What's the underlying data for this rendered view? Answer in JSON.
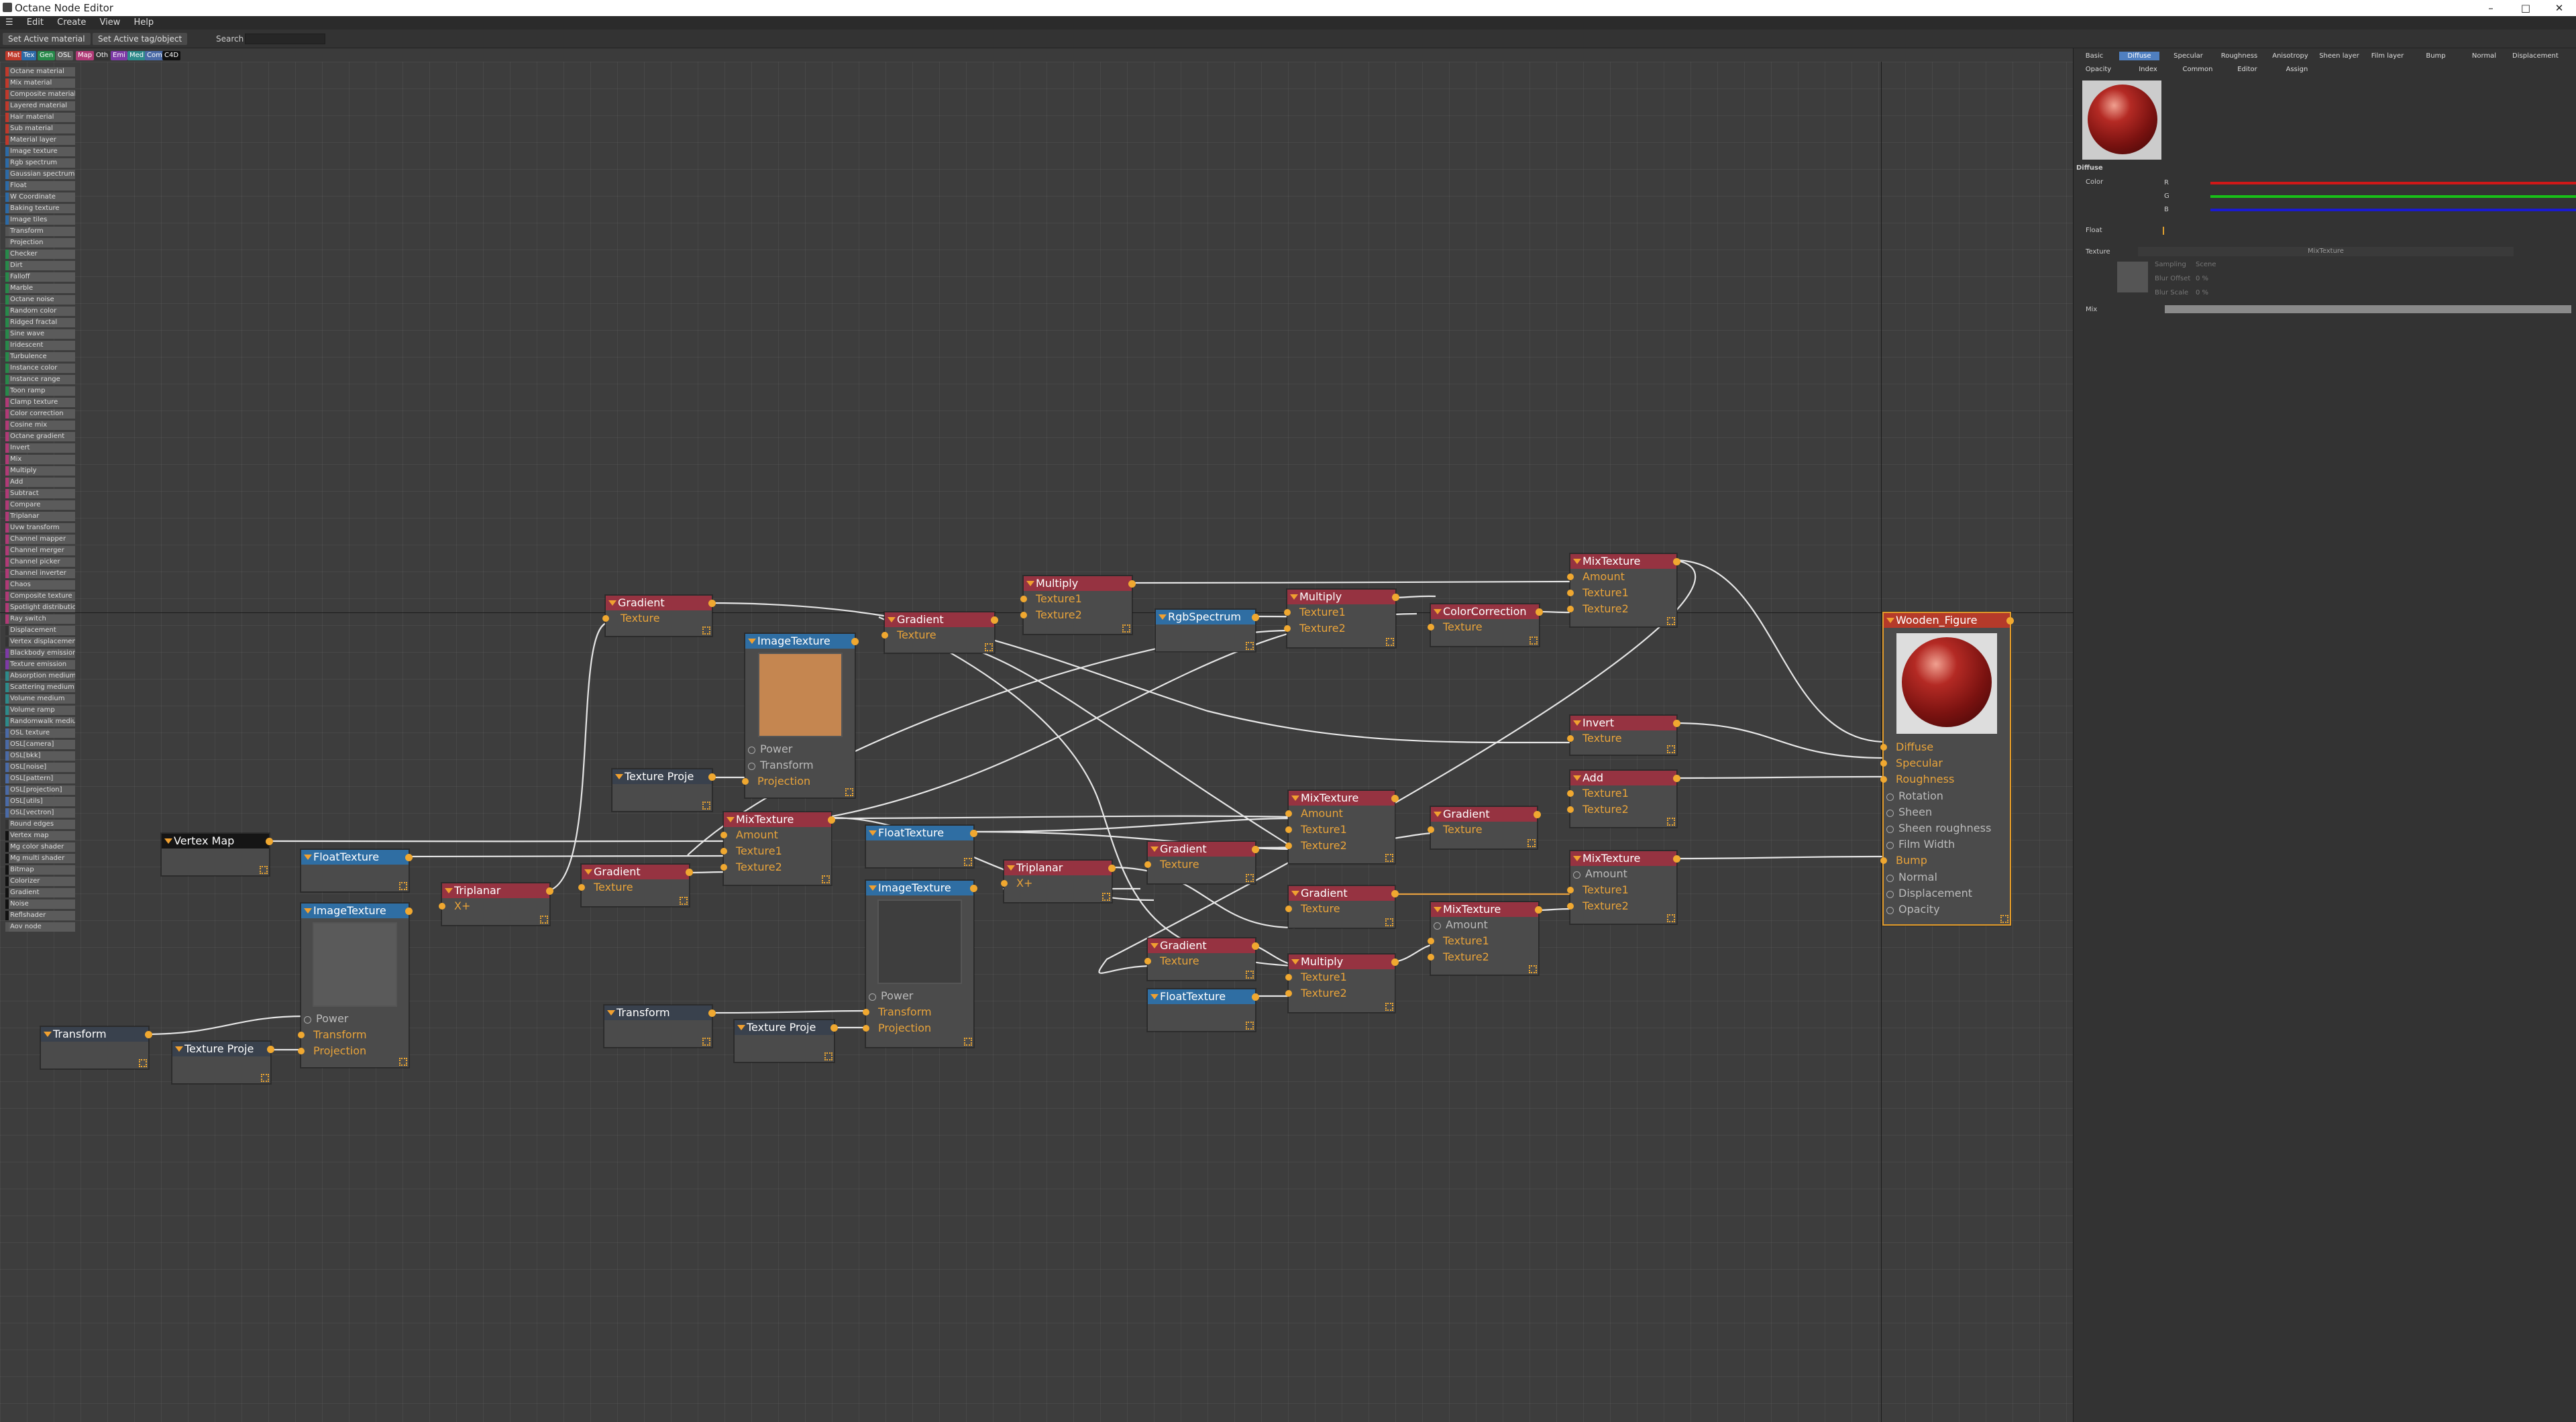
{
  "window": {
    "title": "Octane Node Editor",
    "min": "–",
    "max": "□",
    "close": "✕"
  },
  "menu": [
    "Edit",
    "Create",
    "View",
    "Help"
  ],
  "toolbar": {
    "btn1": "Set Active material",
    "btn2": "Set Active tag/object",
    "search_label": "Search"
  },
  "filters": [
    {
      "label": "Mat",
      "color": "#c0392b"
    },
    {
      "label": "Tex",
      "color": "#2c6aa6"
    },
    {
      "label": "Gen",
      "color": "#27894a"
    },
    {
      "label": "OSL",
      "color": "#5d5d5d"
    },
    {
      "label": "Map",
      "color": "#b03a76"
    },
    {
      "label": "Oth",
      "color": "#333333"
    },
    {
      "label": "Emi",
      "color": "#7d3aa6"
    },
    {
      "label": "Med",
      "color": "#2d8a8a"
    },
    {
      "label": "Com",
      "color": "#4a6aa6"
    },
    {
      "label": "C4D",
      "color": "#111111"
    }
  ],
  "palette": [
    {
      "label": "Octane material",
      "color": "#c0392b"
    },
    {
      "label": "Mix material",
      "color": "#c0392b"
    },
    {
      "label": "Composite material",
      "color": "#c0392b"
    },
    {
      "label": "Layered material",
      "color": "#c0392b"
    },
    {
      "label": "Hair material",
      "color": "#c0392b"
    },
    {
      "label": "Sub material",
      "color": "#c0392b"
    },
    {
      "label": "Material layer",
      "color": "#c0392b"
    },
    {
      "label": "Image texture",
      "color": "#2c6aa6"
    },
    {
      "label": "Rgb spectrum",
      "color": "#2c6aa6"
    },
    {
      "label": "Gaussian spectrum",
      "color": "#2c6aa6"
    },
    {
      "label": "Float",
      "color": "#2c6aa6"
    },
    {
      "label": "W Coordinate",
      "color": "#2c6aa6"
    },
    {
      "label": "Baking texture",
      "color": "#2c6aa6"
    },
    {
      "label": "Image tiles",
      "color": "#2c6aa6"
    },
    {
      "label": "Transform",
      "color": "#555555"
    },
    {
      "label": "Projection",
      "color": "#555555"
    },
    {
      "label": "Checker",
      "color": "#27894a"
    },
    {
      "label": "Dirt",
      "color": "#27894a"
    },
    {
      "label": "Falloff",
      "color": "#27894a"
    },
    {
      "label": "Marble",
      "color": "#27894a"
    },
    {
      "label": "Octane noise",
      "color": "#27894a"
    },
    {
      "label": "Random color",
      "color": "#27894a"
    },
    {
      "label": "Ridged fractal",
      "color": "#27894a"
    },
    {
      "label": "Sine wave",
      "color": "#27894a"
    },
    {
      "label": "Iridescent",
      "color": "#27894a"
    },
    {
      "label": "Turbulence",
      "color": "#27894a"
    },
    {
      "label": "Instance color",
      "color": "#27894a"
    },
    {
      "label": "Instance range",
      "color": "#27894a"
    },
    {
      "label": "Toon ramp",
      "color": "#27894a"
    },
    {
      "label": "Clamp texture",
      "color": "#b03a76"
    },
    {
      "label": "Color correction",
      "color": "#b03a76"
    },
    {
      "label": "Cosine mix",
      "color": "#b03a76"
    },
    {
      "label": "Octane gradient",
      "color": "#b03a76"
    },
    {
      "label": "Invert",
      "color": "#b03a76"
    },
    {
      "label": "Mix",
      "color": "#b03a76"
    },
    {
      "label": "Multiply",
      "color": "#b03a76"
    },
    {
      "label": "Add",
      "color": "#b03a76"
    },
    {
      "label": "Subtract",
      "color": "#b03a76"
    },
    {
      "label": "Compare",
      "color": "#b03a76"
    },
    {
      "label": "Triplanar",
      "color": "#b03a76"
    },
    {
      "label": "Uvw transform",
      "color": "#b03a76"
    },
    {
      "label": "Channel mapper",
      "color": "#b03a76"
    },
    {
      "label": "Channel merger",
      "color": "#b03a76"
    },
    {
      "label": "Channel picker",
      "color": "#b03a76"
    },
    {
      "label": "Channel inverter",
      "color": "#b03a76"
    },
    {
      "label": "Chaos",
      "color": "#b03a76"
    },
    {
      "label": "Composite texture",
      "color": "#b03a76"
    },
    {
      "label": "Spotlight distribution",
      "color": "#b03a76"
    },
    {
      "label": "Ray switch",
      "color": "#b03a76"
    },
    {
      "label": "Displacement",
      "color": "#333333"
    },
    {
      "label": "Vertex displacement",
      "color": "#333333"
    },
    {
      "label": "Blackbody emission",
      "color": "#7d3aa6"
    },
    {
      "label": "Texture emission",
      "color": "#7d3aa6"
    },
    {
      "label": "Absorption medium",
      "color": "#2d8a8a"
    },
    {
      "label": "Scattering medium",
      "color": "#2d8a8a"
    },
    {
      "label": "Volume medium",
      "color": "#2d8a8a"
    },
    {
      "label": "Volume ramp",
      "color": "#2d8a8a"
    },
    {
      "label": "Randomwalk medium",
      "color": "#2d8a8a"
    },
    {
      "label": "OSL texture",
      "color": "#4a6aa6"
    },
    {
      "label": "OSL[camera]",
      "color": "#4a6aa6"
    },
    {
      "label": "OSL[bkk]",
      "color": "#4a6aa6"
    },
    {
      "label": "OSL[noise]",
      "color": "#4a6aa6"
    },
    {
      "label": "OSL[pattern]",
      "color": "#4a6aa6"
    },
    {
      "label": "OSL[projection]",
      "color": "#4a6aa6"
    },
    {
      "label": "OSL[utils]",
      "color": "#4a6aa6"
    },
    {
      "label": "OSL[vectron]",
      "color": "#4a6aa6"
    },
    {
      "label": "Round edges",
      "color": "#333333"
    },
    {
      "label": "Vertex map",
      "color": "#111111"
    },
    {
      "label": "Mg color shader",
      "color": "#111111"
    },
    {
      "label": "Mg multi shader",
      "color": "#111111"
    },
    {
      "label": "Bitmap",
      "color": "#111111"
    },
    {
      "label": "Colorizer",
      "color": "#111111"
    },
    {
      "label": "Gradient",
      "color": "#111111"
    },
    {
      "label": "Noise",
      "color": "#111111"
    },
    {
      "label": "Reflshader",
      "color": "#111111"
    },
    {
      "label": "Aov node",
      "color": "#555555"
    }
  ],
  "nodes": {
    "gradient1": {
      "title": "Gradient",
      "out": "Texture"
    },
    "imagetexture1": {
      "title": "ImageTexture",
      "in1": "Power",
      "in2": "Transform",
      "in3": "Projection"
    },
    "gradient2": {
      "title": "Gradient",
      "out": "Texture"
    },
    "multiply1": {
      "title": "Multiply",
      "a": "Texture1",
      "b": "Texture2"
    },
    "rgbspectrum": {
      "title": "RgbSpectrum"
    },
    "multiply2": {
      "title": "Multiply",
      "a": "Texture1",
      "b": "Texture2"
    },
    "colorcorrection": {
      "title": "ColorCorrection",
      "a": "Texture"
    },
    "mixtexture1": {
      "title": "MixTexture",
      "a": "Amount",
      "b": "Texture1",
      "c": "Texture2"
    },
    "invert": {
      "title": "Invert",
      "a": "Texture"
    },
    "add": {
      "title": "Add",
      "a": "Texture1",
      "b": "Texture2"
    },
    "mixtexture2": {
      "title": "MixTexture",
      "a": "Amount",
      "b": "Texture1",
      "c": "Texture2"
    },
    "mixtexture3": {
      "title": "MixTexture",
      "a": "Amount",
      "b": "Texture1",
      "c": "Texture2"
    },
    "gradient3": {
      "title": "Gradient",
      "a": "Texture"
    },
    "textureproj1": {
      "title": "Texture Proje"
    },
    "vertexmap": {
      "title": "Vertex Map"
    },
    "floattexture1": {
      "title": "FloatTexture"
    },
    "mixtexture4": {
      "title": "MixTexture",
      "a": "Amount",
      "b": "Texture1",
      "c": "Texture2"
    },
    "floattexture2": {
      "title": "FloatTexture"
    },
    "gradient4": {
      "title": "Gradient",
      "out": "Texture"
    },
    "triplanar1": {
      "title": "Triplanar",
      "a": "X+"
    },
    "imagetexture2": {
      "title": "ImageTexture",
      "in1": "Power",
      "in2": "Transform",
      "in3": "Projection"
    },
    "triplanar2": {
      "title": "Triplanar",
      "a": "X+"
    },
    "gradient5": {
      "title": "Gradient",
      "a": "Texture"
    },
    "imagetexture3": {
      "title": "ImageTexture",
      "in1": "Power",
      "in2": "Transform",
      "in3": "Projection"
    },
    "gradient6": {
      "title": "Gradient",
      "a": "Texture"
    },
    "mixtexture5": {
      "title": "MixTexture",
      "a": "Amount",
      "b": "Texture1",
      "c": "Texture2"
    },
    "gradient7": {
      "title": "Gradient",
      "a": "Texture"
    },
    "multiply3": {
      "title": "Multiply",
      "a": "Texture1",
      "b": "Texture2"
    },
    "floattexture3": {
      "title": "FloatTexture"
    },
    "transform1": {
      "title": "Transform"
    },
    "textureproj2": {
      "title": "Texture Proje"
    },
    "transform2": {
      "title": "Transform"
    },
    "textureproj3": {
      "title": "Texture Proje"
    },
    "material": {
      "title": "Wooden_Figure",
      "pins": [
        "Diffuse",
        "Specular",
        "Roughness",
        "Rotation",
        "Sheen",
        "Sheen roughness",
        "Film Width",
        "Bump",
        "Normal",
        "Displacement",
        "Opacity"
      ]
    }
  },
  "rightpanel": {
    "tabs1": [
      "Basic",
      "Diffuse",
      "Specular",
      "Roughness",
      "Anisotropy",
      "Sheen layer",
      "Film layer",
      "Bump",
      "Normal",
      "Displacement"
    ],
    "tabs2": [
      "Opacity",
      "Index",
      "Common",
      "Editor",
      "Assign"
    ],
    "active": "Diffuse",
    "section": "Diffuse",
    "color_label": "Color",
    "r": "R",
    "g": "G",
    "b": "B",
    "float_label": "Float",
    "texture_label": "Texture",
    "texture_value": "MixTexture",
    "sampling": "Sampling",
    "sampling_value": "Scene",
    "blur_offset": "Blur Offset",
    "blur_offset_value": "0 %",
    "blur_scale": "Blur Scale",
    "blur_scale_value": "0 %",
    "mix_label": "Mix",
    "colors": {
      "r": "#d01818",
      "g": "#18c018",
      "b": "#1a1ad0"
    }
  }
}
